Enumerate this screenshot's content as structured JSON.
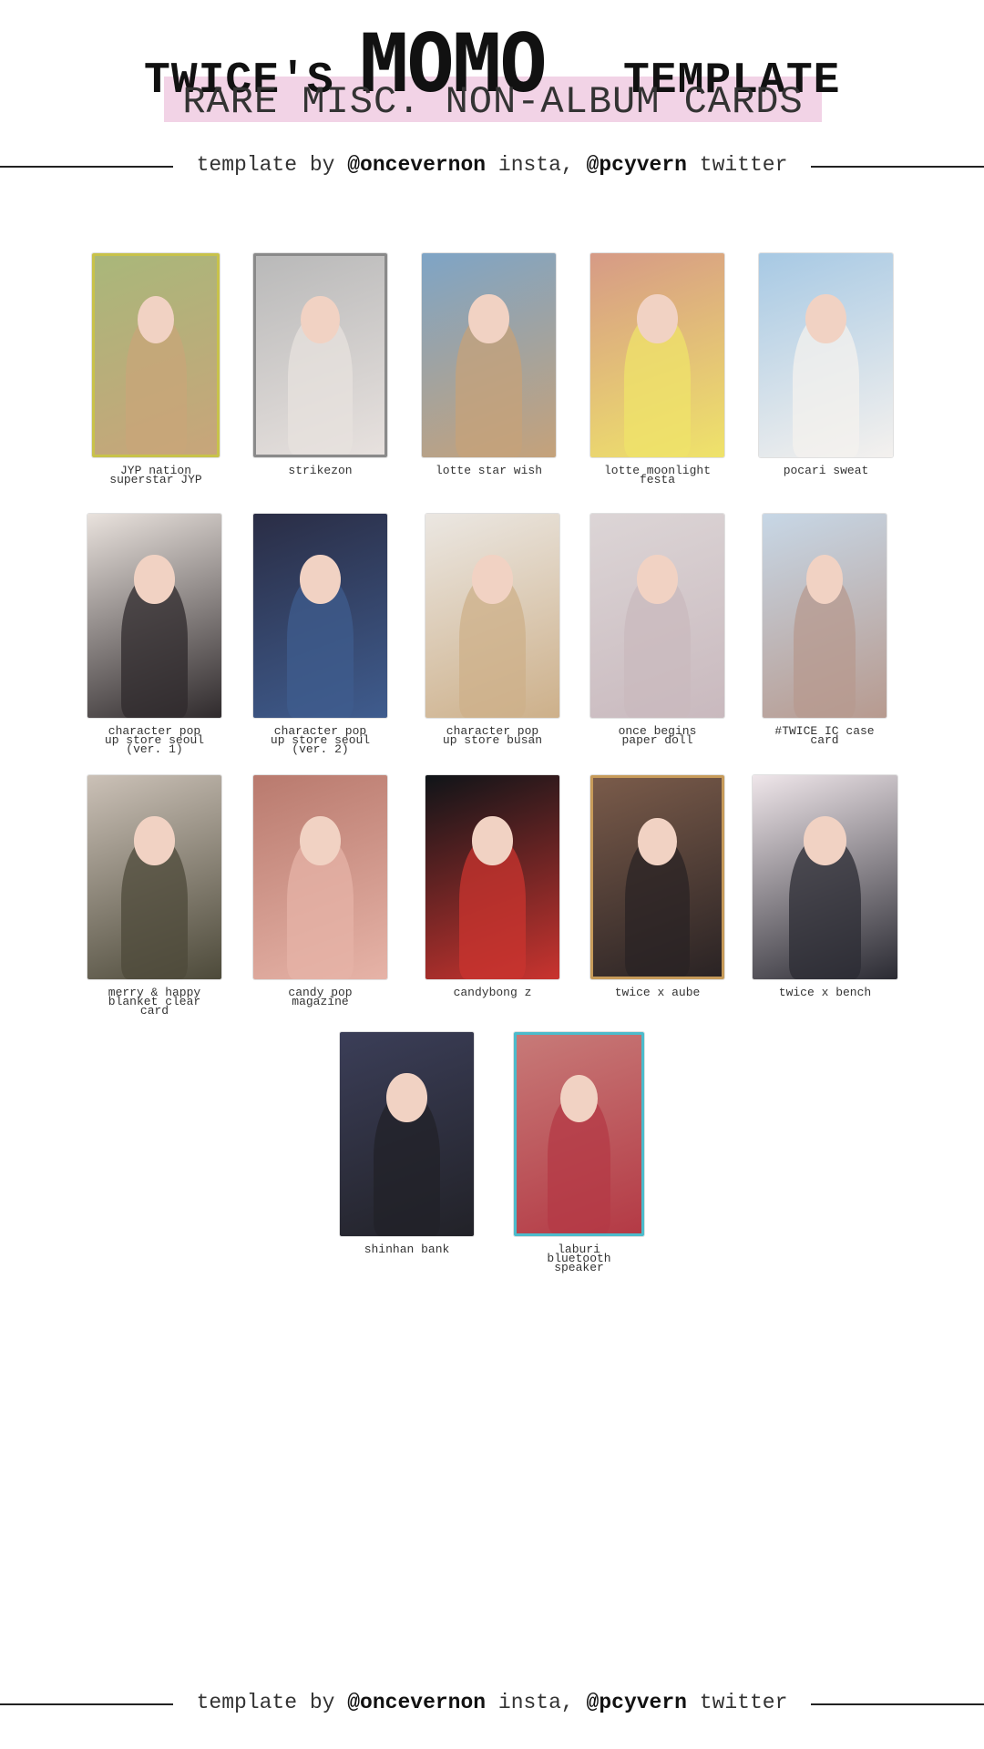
{
  "header": {
    "title_left": "TWICE'S",
    "title_main": "MOMO",
    "title_right": "TEMPLATE",
    "subtitle": "RARE MISC. NON-ALBUM CARDS"
  },
  "credit": {
    "prefix": "template by",
    "handle_insta": "@oncevernon",
    "insta_label": "insta,",
    "handle_twitter": "@pcyvern",
    "twitter_label": "twitter"
  },
  "colors": {
    "subtitle_band": "#f2d3e6",
    "rule": "#222222"
  },
  "cards": [
    {
      "label": "JYP nation\nsuperstar JYP",
      "bg": "#a9b77a",
      "tone": "#c8a57a",
      "border": "#c8c24a"
    },
    {
      "label": "strikezon",
      "bg": "#b9b9b9",
      "tone": "#e7e1de",
      "border": "#8a8a8a"
    },
    {
      "label": "lotte star wish",
      "bg": "#7ea4c6",
      "tone": "#c5a27a",
      "border": ""
    },
    {
      "label": "lotte moonlight\nfesta",
      "bg": "#d69a86",
      "tone": "#efe36a",
      "border": ""
    },
    {
      "label": "pocari sweat",
      "bg": "#a7c9e4",
      "tone": "#f4f1ee",
      "border": ""
    },
    {
      "label": "character pop\nup store seoul\n(ver. 1)",
      "bg": "#e9e2dd",
      "tone": "#2f2a2c",
      "border": ""
    },
    {
      "label": "character pop\nup store seoul\n(ver. 2)",
      "bg": "#2a2d45",
      "tone": "#3f5c8e",
      "border": ""
    },
    {
      "label": "character pop\nup store busan",
      "bg": "#ebe7e2",
      "tone": "#cdb08a",
      "border": ""
    },
    {
      "label": "once begins\npaper doll",
      "bg": "#dcd5d6",
      "tone": "#c9b9be",
      "border": ""
    },
    {
      "label": "#TWICE IC case\ncard",
      "bg": "#c7d7e6",
      "tone": "#b79a8f",
      "border": ""
    },
    {
      "label": "merry & happy\nblanket clear\ncard",
      "bg": "#cbc1b7",
      "tone": "#4d4a3a",
      "border": ""
    },
    {
      "label": "candy pop\nmagazine",
      "bg": "#b97a6e",
      "tone": "#e6b3a7",
      "border": ""
    },
    {
      "label": "candybong z",
      "bg": "#0f1418",
      "tone": "#c9342f",
      "border": ""
    },
    {
      "label": "twice x aube",
      "bg": "#7a5b4a",
      "tone": "#2a2324",
      "border": "#c79b5a"
    },
    {
      "label": "twice x bench",
      "bg": "#efe6ea",
      "tone": "#2b2b33",
      "border": ""
    },
    {
      "label": "shinhan bank",
      "bg": "#3b3e58",
      "tone": "#222228",
      "border": ""
    },
    {
      "label": "laburi\nbluetooth\nspeaker",
      "bg": "#c77a78",
      "tone": "#b43a45",
      "border": "#4cbccc"
    }
  ]
}
